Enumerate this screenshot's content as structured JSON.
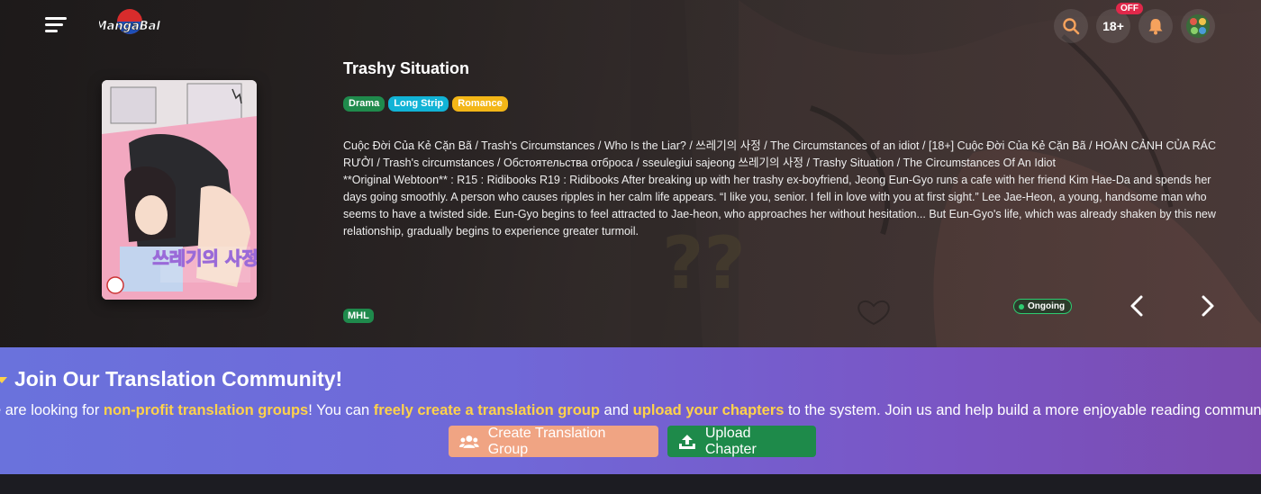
{
  "header": {
    "logo_text": "MangaBall",
    "age_badge": "18+",
    "age_badge_status": "OFF"
  },
  "manga": {
    "title": "Trashy Situation",
    "tags": [
      {
        "label": "Drama",
        "color": "#1f8a4c"
      },
      {
        "label": "Long Strip",
        "color": "#11b3d6"
      },
      {
        "label": "Romance",
        "color": "#f3b617"
      }
    ],
    "alt_titles": "Cuộc Đời Của Kẻ Cặn Bã / Trash's Circumstances / Who Is the Liar? / 쓰레기의 사정 / The Circumstances of an idiot / [18+] Cuộc Đời Của Kẻ Cặn Bã / HOÀN CẢNH CỦA RÁC RƯỞI / Trash's circumstances / Обстоятельства отброса / sseulegiui sajeong 쓰레기의 사정 / Trashy Situation / The Circumstances Of An Idiot",
    "synopsis": "**Original Webtoon** : R15 : Ridibooks R19 : Ridibooks After breaking up with her trashy ex-boyfriend, Jeong Eun-Gyo runs a cafe with her friend Kim Hae-Da and spends her days going smoothly. A person who causes ripples in her calm life appears. “I like you, senior. I fell in love with you at first sight.” Lee Jae-Heon, a young, handsome man who seems to have a twisted side. Eun-Gyo begins to feel attracted to Jae-heon, who approaches her without hesitation... But Eun-Gyo's life, which was already shaken by this new relationship, gradually begins to experience greater turmoil.",
    "group": "MHL",
    "status": "Ongoing",
    "cover_title_text": "쓰레기의 사정"
  },
  "banner": {
    "title": "Join Our Translation Community!",
    "text_1": "e are looking for ",
    "highlight_1": "non-profit translation groups",
    "text_2": "! You can ",
    "highlight_2": "freely create a translation group",
    "text_3": " and ",
    "highlight_3": "upload your chapters",
    "text_4": " to the system. Join us and help build a more enjoyable reading communit",
    "create_button": "Create Translation Group",
    "upload_button": "Upload Chapter"
  },
  "colors": {
    "accent_yellow": "#ffd24a",
    "banner_gradient_start": "#6a72dc",
    "banner_gradient_end": "#7b4bb0",
    "upload_green": "#1e8a4a",
    "create_orange": "#f0a483",
    "search_icon": "#f5a25d",
    "bell_icon": "#f5a25d"
  }
}
